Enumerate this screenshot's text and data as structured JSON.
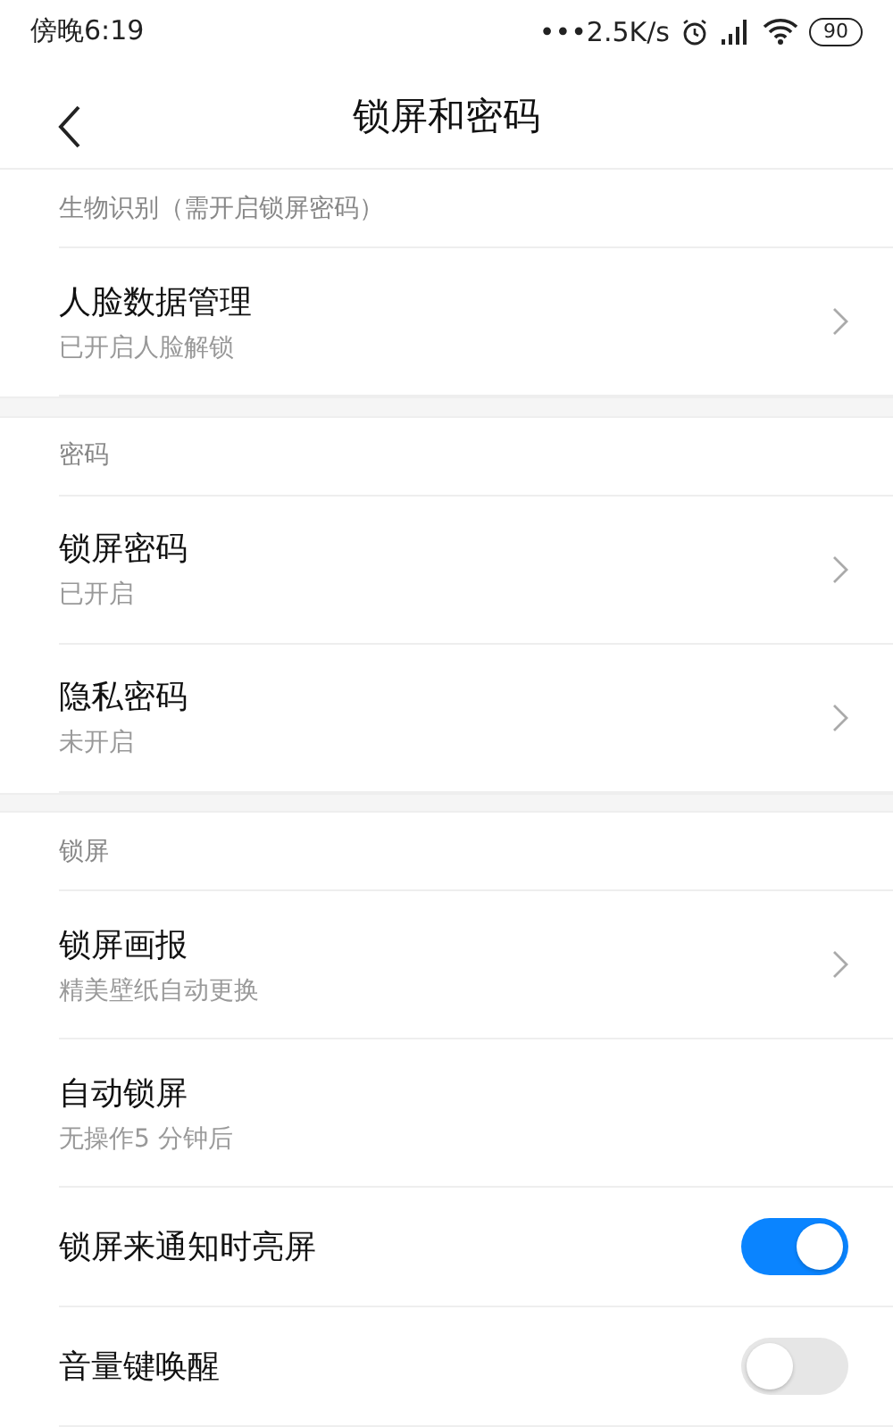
{
  "status_bar": {
    "time": "傍晚6:19",
    "speed": "•••2.5K/s",
    "battery": "90"
  },
  "header": {
    "title": "锁屏和密码"
  },
  "sections": [
    {
      "title": "生物识别（需开启锁屏密码）",
      "items": [
        {
          "kind": "link",
          "title": "人脸数据管理",
          "subtitle": "已开启人脸解锁"
        }
      ]
    },
    {
      "title": "密码",
      "items": [
        {
          "kind": "link",
          "title": "锁屏密码",
          "subtitle": "已开启"
        },
        {
          "kind": "link",
          "title": "隐私密码",
          "subtitle": "未开启"
        }
      ]
    },
    {
      "title": "锁屏",
      "items": [
        {
          "kind": "link",
          "title": "锁屏画报",
          "subtitle": "精美壁纸自动更换"
        },
        {
          "kind": "plain",
          "title": "自动锁屏",
          "subtitle": "无操作5 分钟后"
        },
        {
          "kind": "toggle",
          "title": "锁屏来通知时亮屏",
          "on": true
        },
        {
          "kind": "toggle",
          "title": "音量键唤醒",
          "on": false
        }
      ]
    }
  ]
}
